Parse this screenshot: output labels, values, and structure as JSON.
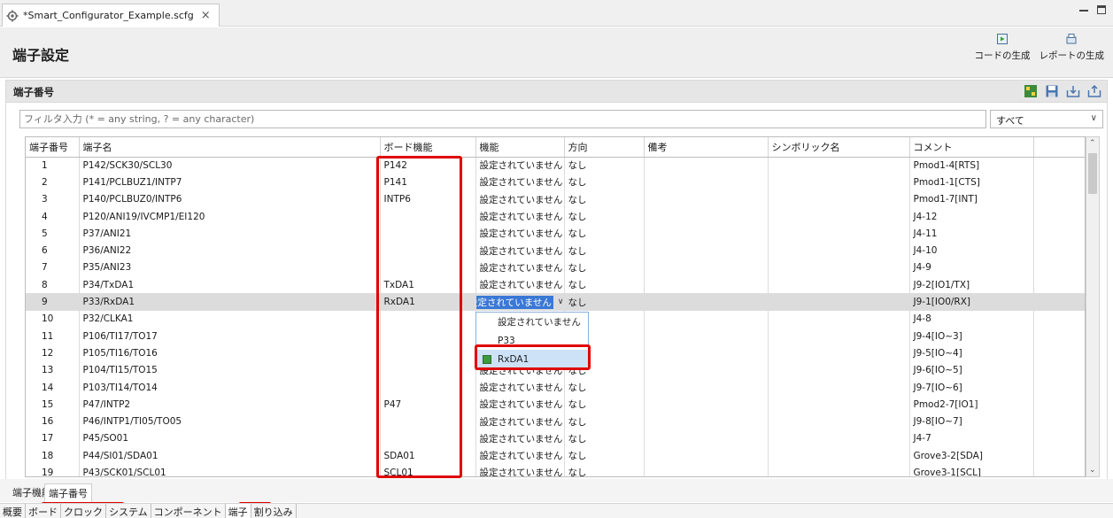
{
  "editor": {
    "tab_title": "*Smart_Configurator_Example.scfg",
    "close_glyph": "×"
  },
  "header": {
    "title": "端子設定",
    "generate_code_label": "コードの生成",
    "generate_report_label": "レポートの生成"
  },
  "section": {
    "title": "端子番号"
  },
  "filter": {
    "placeholder": "フィルタ入力 (* = any string, ? = any character)",
    "value": "",
    "scope_selected": "すべて"
  },
  "table": {
    "columns": [
      "端子番号",
      "端子名",
      "ボード機能",
      "機能",
      "方向",
      "備考",
      "シンボリック名",
      "コメント"
    ],
    "rows": [
      {
        "no": "1",
        "name": "P142/SCK30/SCL30",
        "board": "P142",
        "func": "設定されていません",
        "dir": "なし",
        "note": "",
        "sym": "",
        "comment": "Pmod1-4[RTS]"
      },
      {
        "no": "2",
        "name": "P141/PCLBUZ1/INTP7",
        "board": "P141",
        "func": "設定されていません",
        "dir": "なし",
        "note": "",
        "sym": "",
        "comment": "Pmod1-1[CTS]"
      },
      {
        "no": "3",
        "name": "P140/PCLBUZ0/INTP6",
        "board": "INTP6",
        "func": "設定されていません",
        "dir": "なし",
        "note": "",
        "sym": "",
        "comment": "Pmod1-7[INT]"
      },
      {
        "no": "4",
        "name": "P120/ANI19/IVCMP1/EI120",
        "board": "",
        "func": "設定されていません",
        "dir": "なし",
        "note": "",
        "sym": "",
        "comment": "J4-12"
      },
      {
        "no": "5",
        "name": "P37/ANI21",
        "board": "",
        "func": "設定されていません",
        "dir": "なし",
        "note": "",
        "sym": "",
        "comment": "J4-11"
      },
      {
        "no": "6",
        "name": "P36/ANI22",
        "board": "",
        "func": "設定されていません",
        "dir": "なし",
        "note": "",
        "sym": "",
        "comment": "J4-10"
      },
      {
        "no": "7",
        "name": "P35/ANI23",
        "board": "",
        "func": "設定されていません",
        "dir": "なし",
        "note": "",
        "sym": "",
        "comment": "J4-9"
      },
      {
        "no": "8",
        "name": "P34/TxDA1",
        "board": "TxDA1",
        "func": "設定されていません",
        "dir": "なし",
        "note": "",
        "sym": "",
        "comment": "J9-2[IO1/TX]"
      },
      {
        "no": "9",
        "name": "P33/RxDA1",
        "board": "RxDA1",
        "func": "設定されていません",
        "dir": "なし",
        "note": "",
        "sym": "",
        "comment": "J9-1[IO0/RX]"
      },
      {
        "no": "10",
        "name": "P32/CLKA1",
        "board": "",
        "func": "",
        "dir": "",
        "note": "",
        "sym": "",
        "comment": "J4-8"
      },
      {
        "no": "11",
        "name": "P106/TI17/TO17",
        "board": "",
        "func": "",
        "dir": "",
        "note": "",
        "sym": "",
        "comment": "J9-4[IO~3]"
      },
      {
        "no": "12",
        "name": "P105/TI16/TO16",
        "board": "",
        "func": "",
        "dir": "",
        "note": "",
        "sym": "",
        "comment": "J9-5[IO~4]"
      },
      {
        "no": "13",
        "name": "P104/TI15/TO15",
        "board": "",
        "func": "設定されていません",
        "dir": "なし",
        "note": "",
        "sym": "",
        "comment": "J9-6[IO~5]"
      },
      {
        "no": "14",
        "name": "P103/TI14/TO14",
        "board": "",
        "func": "設定されていません",
        "dir": "なし",
        "note": "",
        "sym": "",
        "comment": "J9-7[IO~6]"
      },
      {
        "no": "15",
        "name": "P47/INTP2",
        "board": "P47",
        "func": "設定されていません",
        "dir": "なし",
        "note": "",
        "sym": "",
        "comment": "Pmod2-7[IO1]"
      },
      {
        "no": "16",
        "name": "P46/INTP1/TI05/TO05",
        "board": "",
        "func": "設定されていません",
        "dir": "なし",
        "note": "",
        "sym": "",
        "comment": "J9-8[IO~7]"
      },
      {
        "no": "17",
        "name": "P45/SO01",
        "board": "",
        "func": "設定されていません",
        "dir": "なし",
        "note": "",
        "sym": "",
        "comment": "J4-7"
      },
      {
        "no": "18",
        "name": "P44/SI01/SDA01",
        "board": "SDA01",
        "func": "設定されていません",
        "dir": "なし",
        "note": "",
        "sym": "",
        "comment": "Grove3-2[SDA]"
      },
      {
        "no": "19",
        "name": "P43/SCK01/SCL01",
        "board": "SCL01",
        "func": "設定されていません",
        "dir": "なし",
        "note": "",
        "sym": "",
        "comment": "Grove3-1[SCL]"
      }
    ],
    "selected_row_index": 8
  },
  "dropdown": {
    "options": [
      "設定されていません",
      "P33",
      "RxDA1"
    ],
    "highlighted_option": "RxDA1"
  },
  "page_tabs": [
    "端子機能",
    "端子番号"
  ],
  "active_page_tab": "端子番号",
  "nav_tabs": [
    "概要",
    "ボード",
    "クロック",
    "システム",
    "コンポーネント",
    "端子",
    "割り込み"
  ],
  "active_nav_tab": "端子",
  "colors": {
    "highlight_red": "#e00000",
    "selection_blue": "#3a78d6",
    "board_chip_green": "#3d9a3d"
  }
}
